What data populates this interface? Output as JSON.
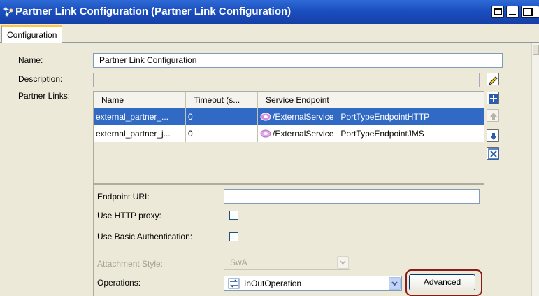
{
  "window": {
    "title": "Partner Link Configuration (Partner Link Configuration)"
  },
  "tabs": [
    {
      "label": "Configuration",
      "active": true
    }
  ],
  "form": {
    "name_label": "Name:",
    "name_value": "Partner Link Configuration",
    "description_label": "Description:",
    "description_value": "",
    "partner_links_label": "Partner Links:"
  },
  "partner_links_table": {
    "columns": [
      "Name",
      "Timeout (s...",
      "Service Endpoint"
    ],
    "rows": [
      {
        "name": "external_partner_...",
        "timeout": "0",
        "service": "/ExternalService",
        "endpoint": "PortTypeEndpointHTTP",
        "selected": true
      },
      {
        "name": "external_partner_j...",
        "timeout": "0",
        "service": "/ExternalService",
        "endpoint": "PortTypeEndpointJMS",
        "selected": false
      }
    ]
  },
  "endpoint": {
    "endpoint_uri_label": "Endpoint URI:",
    "endpoint_uri_value": "",
    "http_proxy_label": "Use HTTP proxy:",
    "http_proxy_checked": false,
    "basic_auth_label": "Use Basic Authentication:",
    "basic_auth_checked": false,
    "attachment_style_label": "Attachment Style:",
    "attachment_style_value": "SwA",
    "operations_label": "Operations:",
    "operations_value": "InOutOperation",
    "advanced_label": "Advanced"
  },
  "icons": {
    "title": "partner-link-icon",
    "edit": "pencil-icon",
    "add": "plus-icon",
    "move_up": "arrow-up-icon",
    "move_down": "arrow-down-icon",
    "delete": "x-icon",
    "operation": "inout-operation-icon"
  },
  "colors": {
    "title_bar": "#1b4fbf",
    "selection": "#316ac5",
    "highlight_ring": "#8b1a1a"
  }
}
